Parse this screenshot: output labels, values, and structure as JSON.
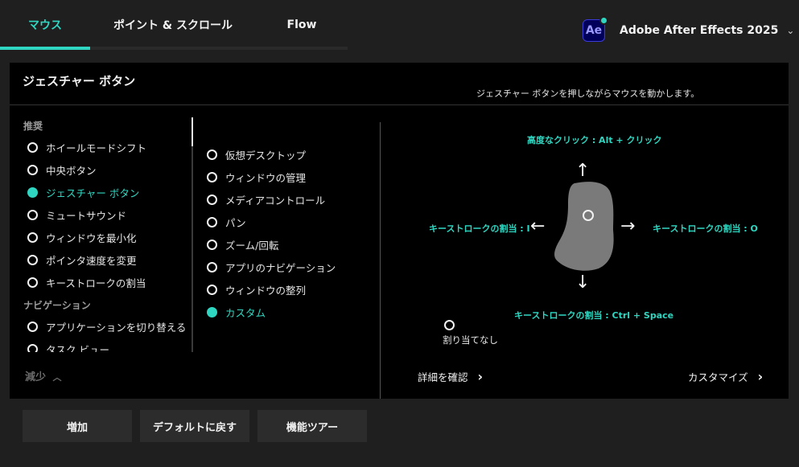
{
  "tabs": [
    {
      "label": "マウス",
      "active": true
    },
    {
      "label": "ポイント & スクロール",
      "active": false
    },
    {
      "label": "Flow",
      "active": false
    }
  ],
  "app_selector": {
    "icon_text": "Ae",
    "name": "Adobe After Effects 2025",
    "chevron": "⌄"
  },
  "panel": {
    "title": "ジェスチャー ボタン",
    "description": "ジェスチャー ボタンを押しながらマウスを動かします。"
  },
  "left_list": {
    "section_recommended": "推奨",
    "recommended": [
      {
        "label": "ホイールモードシフト",
        "selected": false
      },
      {
        "label": "中央ボタン",
        "selected": false
      },
      {
        "label": "ジェスチャー ボタン",
        "selected": true
      },
      {
        "label": "ミュートサウンド",
        "selected": false
      },
      {
        "label": "ウィンドウを最小化",
        "selected": false
      },
      {
        "label": "ポインタ速度を変更",
        "selected": false
      },
      {
        "label": "キーストロークの割当",
        "selected": false
      }
    ],
    "section_navigation": "ナビゲーション",
    "navigation": [
      {
        "label": "アプリケーションを切り替える",
        "selected": false
      },
      {
        "label": "タスク ビュー",
        "selected": false
      }
    ],
    "less_label": "減少"
  },
  "middle_list": [
    {
      "label": "仮想デスクトップ",
      "selected": false
    },
    {
      "label": "ウィンドウの管理",
      "selected": false
    },
    {
      "label": "メディアコントロール",
      "selected": false
    },
    {
      "label": "パン",
      "selected": false
    },
    {
      "label": "ズーム/回転",
      "selected": false
    },
    {
      "label": "アプリのナビゲーション",
      "selected": false
    },
    {
      "label": "ウィンドウの整列",
      "selected": false
    },
    {
      "label": "カスタム",
      "selected": true
    }
  ],
  "gesture": {
    "up": "高度なクリック : Alt + クリック",
    "left": "キーストロークの割当 : I",
    "right": "キーストロークの割当 : O",
    "down": "キーストロークの割当 : Ctrl + Space",
    "unassigned": "割り当てなし",
    "arrow_up": "↑",
    "arrow_down": "↓",
    "arrow_left": "←",
    "arrow_right": "→"
  },
  "links": {
    "details": "詳細を確認",
    "customize": "カスタマイズ",
    "chevron": "›"
  },
  "buttons": {
    "add": "増加",
    "reset": "デフォルトに戻す",
    "tour": "機能ツアー"
  },
  "colors": {
    "accent": "#2fd6c1",
    "panel_bg": "#000000",
    "page_bg": "#1f1f1f",
    "mouse_shape": "#7a7a7a"
  }
}
